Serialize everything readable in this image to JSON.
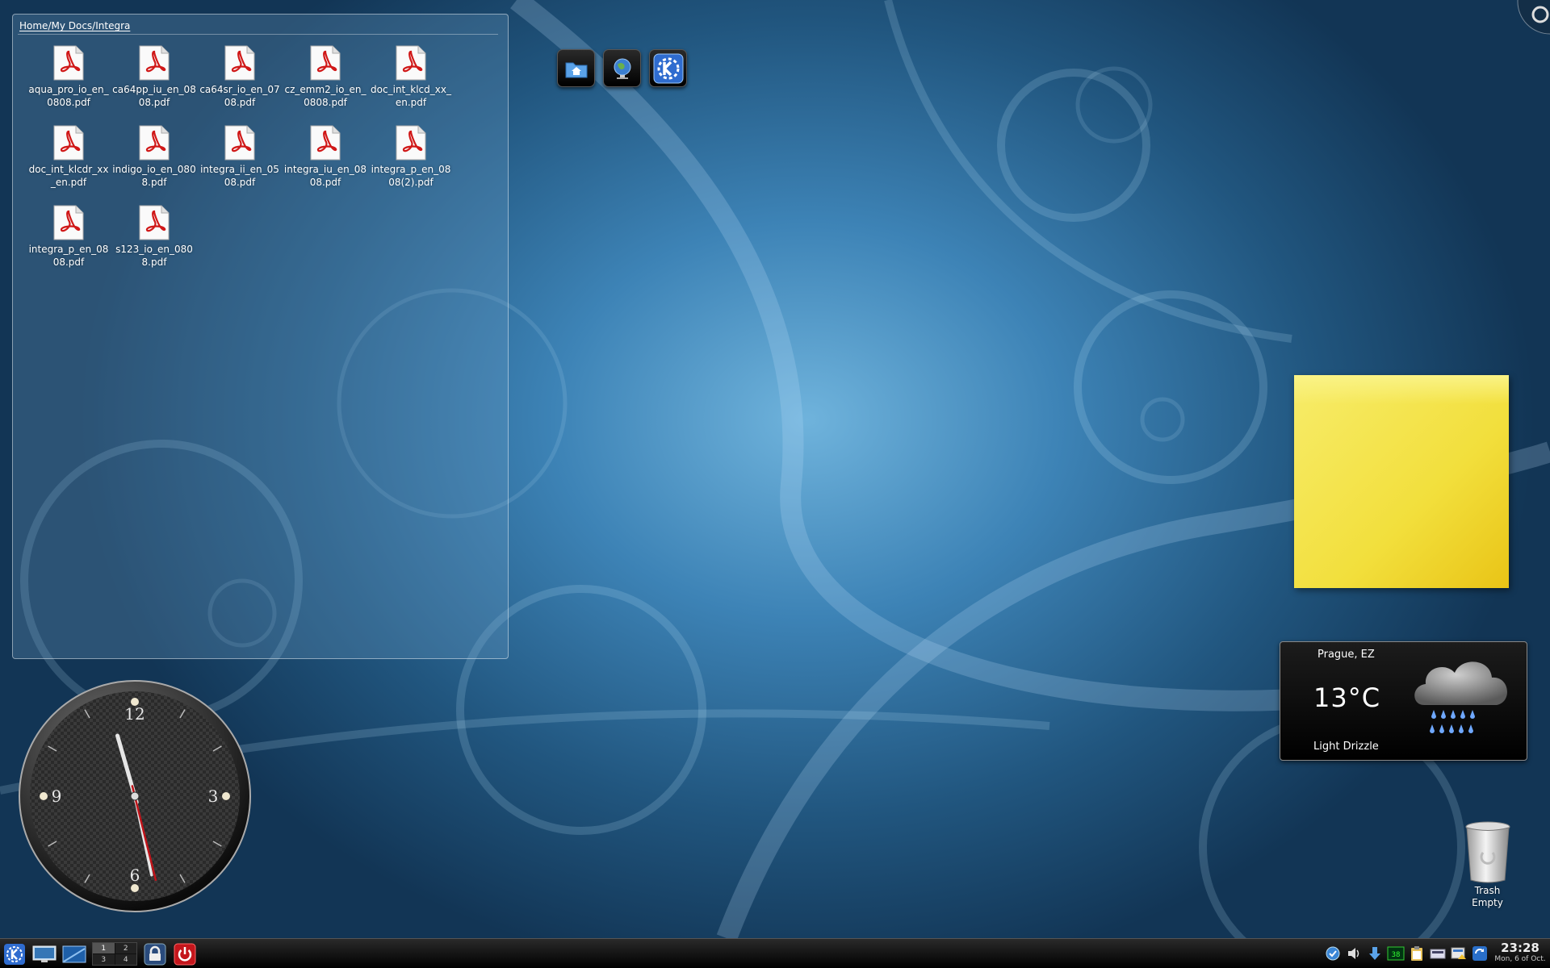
{
  "folder_view": {
    "path": "Home/My Docs/Integra",
    "files": [
      {
        "name": "aqua_pro_io_en_0808.pdf"
      },
      {
        "name": "ca64pp_iu_en_0808.pdf"
      },
      {
        "name": "ca64sr_io_en_0708.pdf"
      },
      {
        "name": "cz_emm2_io_en_0808.pdf"
      },
      {
        "name": "doc_int_klcd_xx_en.pdf"
      },
      {
        "name": "doc_int_klcdr_xx_en.pdf"
      },
      {
        "name": "indigo_io_en_0808.pdf"
      },
      {
        "name": "integra_ii_en_0508.pdf"
      },
      {
        "name": "integra_iu_en_0808.pdf"
      },
      {
        "name": "integra_p_en_0808(2).pdf"
      },
      {
        "name": "integra_p_en_0808.pdf"
      },
      {
        "name": "s123_io_en_0808.pdf"
      }
    ]
  },
  "quicklaunch": [
    {
      "icon": "home-folder-icon"
    },
    {
      "icon": "web-browser-icon"
    },
    {
      "icon": "kde-icon"
    }
  ],
  "weather": {
    "location": "Prague, EZ",
    "temperature": "13°C",
    "condition": "Light Drizzle",
    "icon": "rain-cloud-icon"
  },
  "trash": {
    "label": "Trash",
    "status": "Empty"
  },
  "clock": {
    "numerals": [
      "12",
      "3",
      "6",
      "9"
    ],
    "time": "23:28"
  },
  "taskbar": {
    "pager": [
      "1",
      "2",
      "3",
      "4"
    ],
    "active_desktop": "1",
    "tray_number": "38",
    "time": "23:28",
    "date": "Mon, 6 of Oct."
  },
  "colors": {
    "sticky_note": "#f2df3c",
    "clock_second_hand": "#c0141a",
    "pdf_red": "#d01818"
  }
}
